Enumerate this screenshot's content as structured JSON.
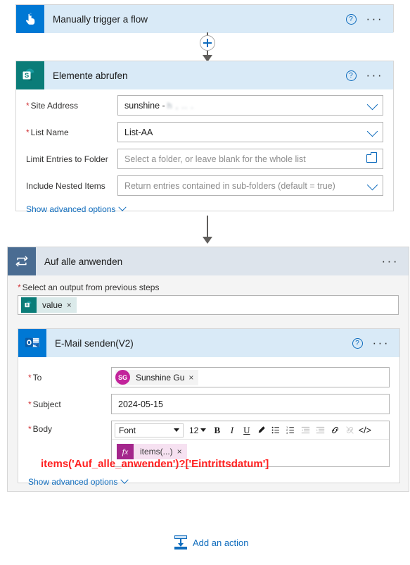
{
  "flow": {
    "trigger": {
      "title": "Manually trigger a flow",
      "icon": "hand-tap-icon",
      "help_label": "?",
      "menu_label": "···"
    },
    "get_items": {
      "title": "Elemente abrufen",
      "icon": "sharepoint-icon",
      "help_label": "?",
      "menu_label": "···",
      "fields": [
        {
          "label": "Site Address",
          "required": true,
          "value": "sunshine -",
          "redacted_suffix": "h   ,  ..                    .",
          "control": "dropdown",
          "is_placeholder": false
        },
        {
          "label": "List Name",
          "required": true,
          "value": "List-AA",
          "control": "dropdown",
          "is_placeholder": false
        },
        {
          "label": "Limit Entries to Folder",
          "required": false,
          "value": "Select a folder, or leave blank for the whole list",
          "control": "folder-picker",
          "is_placeholder": true
        },
        {
          "label": "Include Nested Items",
          "required": false,
          "value": "Return entries contained in sub-folders (default = true)",
          "control": "dropdown",
          "is_placeholder": true
        }
      ],
      "show_advanced": "Show advanced options"
    },
    "apply_to_each": {
      "title": "Auf alle anwenden",
      "icon": "loop-icon",
      "menu_label": "···",
      "select_output_label": "Select an output from previous steps",
      "select_output_required": true,
      "token": {
        "text": "value",
        "icon": "sharepoint-icon",
        "remove_label": "×"
      }
    },
    "send_email": {
      "title": "E-Mail senden(V2)",
      "icon": "outlook-icon",
      "help_label": "?",
      "menu_label": "···",
      "to": {
        "label": "To",
        "required": true,
        "person": {
          "initials": "SG",
          "name": "Sunshine Gu",
          "remove_label": "×",
          "avatar_color": "#c2239b"
        }
      },
      "subject": {
        "label": "Subject",
        "required": true,
        "value": "2024-05-15"
      },
      "body": {
        "label": "Body",
        "required": true,
        "toolbar": {
          "font_label": "Font",
          "size_label": "12",
          "bold": "B",
          "italic": "I",
          "underline": "U",
          "text_color": "✎",
          "bulleted_list": "☰",
          "numbered_list": "☷",
          "decrease_indent": "☰",
          "increase_indent": "☰",
          "link": "🔗",
          "unlink": "🔗",
          "code_view": "</>"
        },
        "token": {
          "fx_label": "fx",
          "text": "items(...)",
          "remove_label": "×"
        }
      },
      "show_advanced": "Show advanced options"
    },
    "annotation": "items('Auf_alle_anwenden')?['Eintrittsdatum']",
    "add_action": {
      "label": "Add an action",
      "icon": "insert-action-icon"
    },
    "plus_button_label": "+"
  },
  "colors": {
    "accent": "#0078d4",
    "link": "#0f6cbd",
    "sharepoint": "#0a7c78",
    "outlook": "#0078d4",
    "loop": "#4a6c92",
    "annotation": "#ff2020",
    "required": "#d13438",
    "header_blue": "#d9eaf7",
    "header_plain": "#dde4ec"
  }
}
